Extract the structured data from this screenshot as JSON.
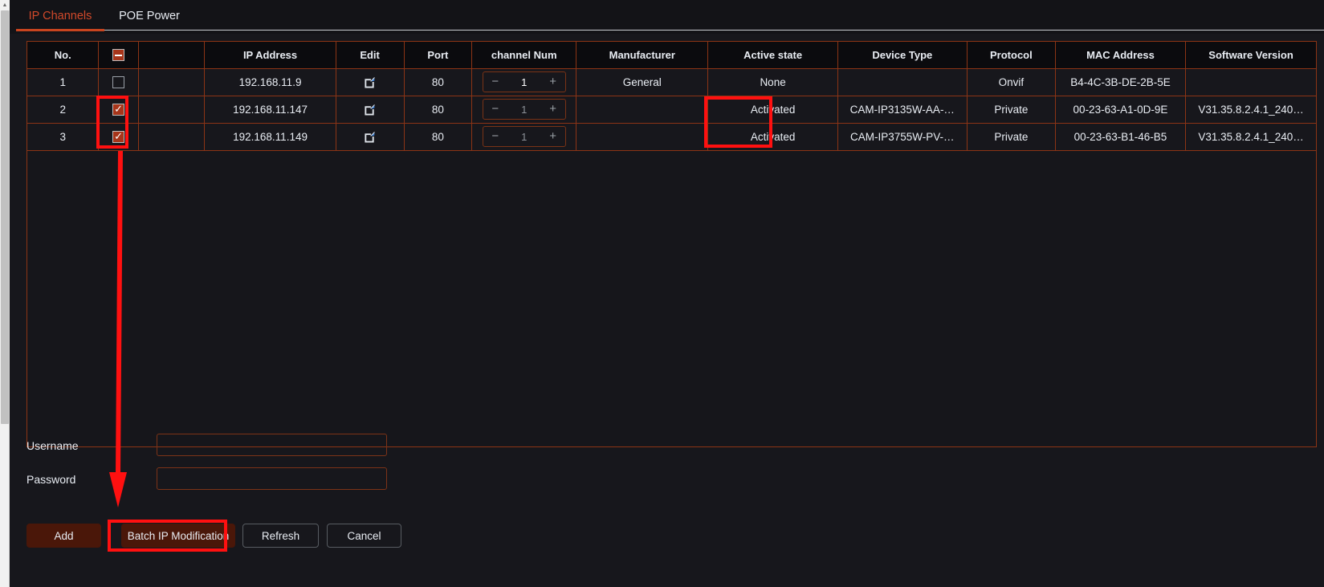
{
  "tabs": [
    {
      "label": "IP Channels",
      "active": true
    },
    {
      "label": "POE Power",
      "active": false
    }
  ],
  "table": {
    "columns": [
      "No.",
      "",
      "",
      "IP Address",
      "Edit",
      "Port",
      "channel Num",
      "Manufacturer",
      "Active state",
      "Device Type",
      "Protocol",
      "MAC Address",
      "Software Version"
    ],
    "header_checkbox_state": "indeterminate",
    "rows": [
      {
        "no": "1",
        "checked": false,
        "blank": "",
        "ip_address": "192.168.11.9",
        "edit_icon": "edit-pencil-icon",
        "port": "80",
        "channel_num": "1",
        "channel_active": true,
        "manufacturer": "General",
        "active_state": "None",
        "device_type": "",
        "protocol": "Onvif",
        "mac_address": "B4-4C-3B-DE-2B-5E",
        "software_version": ""
      },
      {
        "no": "2",
        "checked": true,
        "blank": "",
        "ip_address": "192.168.11.147",
        "edit_icon": "edit-pencil-icon",
        "port": "80",
        "channel_num": "1",
        "channel_active": false,
        "manufacturer": "",
        "active_state": "Activated",
        "device_type": "CAM-IP3135W-AA-…",
        "protocol": "Private",
        "mac_address": "00-23-63-A1-0D-9E",
        "software_version": "V31.35.8.2.4.1_240…"
      },
      {
        "no": "3",
        "checked": true,
        "blank": "",
        "ip_address": "192.168.11.149",
        "edit_icon": "edit-pencil-icon",
        "port": "80",
        "channel_num": "1",
        "channel_active": false,
        "manufacturer": "",
        "active_state": "Activated",
        "device_type": "CAM-IP3755W-PV-…",
        "protocol": "Private",
        "mac_address": "00-23-63-B1-46-B5",
        "software_version": "V31.35.8.2.4.1_240…"
      }
    ],
    "stepper": {
      "minus": "−",
      "plus": "+"
    }
  },
  "form": {
    "username_label": "Username",
    "username_value": "",
    "username_placeholder": "",
    "password_label": "Password",
    "password_value": "",
    "password_placeholder": ""
  },
  "buttons": {
    "add": "Add",
    "batch_ip_modification": "Batch IP Modification",
    "refresh": "Refresh",
    "cancel": "Cancel"
  },
  "colors": {
    "accent_orange": "#c8441f",
    "table_border": "#8c3415",
    "annotation_red": "#ff1010",
    "primary_button_bg": "#4a1709",
    "background": "#17171c"
  },
  "annotations": {
    "checkbox_highlight": "red-rectangle",
    "active_state_highlight": "red-rectangle",
    "batch_button_highlight": "red-rectangle",
    "arrow": "red-arrow-pointing-down-to-batch-button"
  }
}
